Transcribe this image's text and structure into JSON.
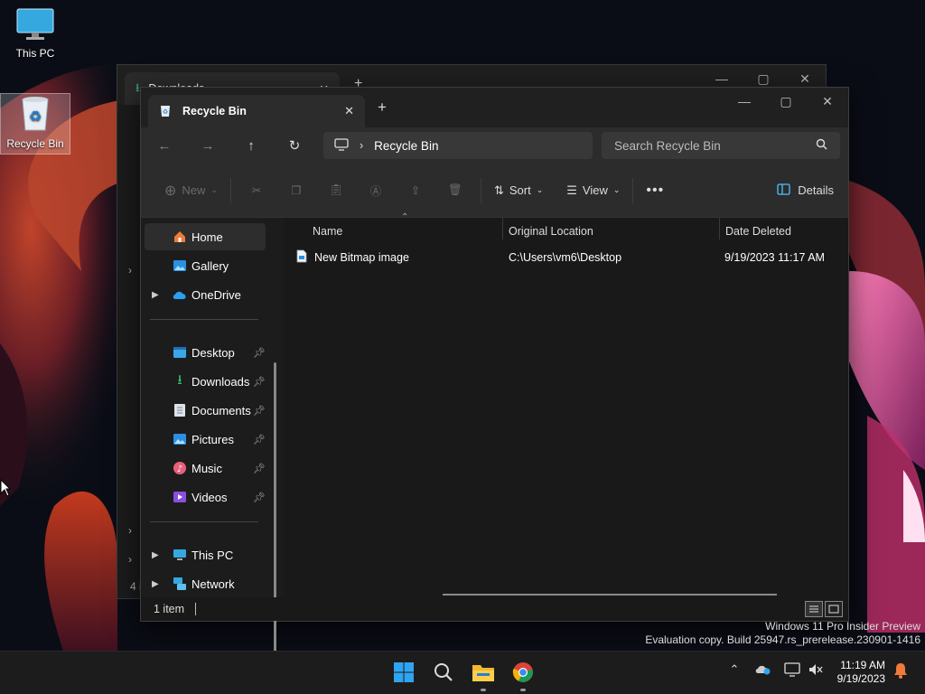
{
  "desktop": {
    "icons": [
      {
        "label": "This PC"
      },
      {
        "label": "Recycle Bin"
      }
    ],
    "watermark": {
      "line1": "Windows 11 Pro Insider Preview",
      "line2": "Evaluation copy. Build 25947.rs_prerelease.230901-1416"
    }
  },
  "background_window": {
    "tab_title": "Downloads",
    "status": "4 i"
  },
  "window": {
    "tab_title": "Recycle Bin",
    "breadcrumb": "Recycle Bin",
    "search_placeholder": "Search Recycle Bin",
    "toolbar": {
      "new_label": "New",
      "sort_label": "Sort",
      "view_label": "View",
      "details_label": "Details"
    },
    "nav": {
      "items": [
        {
          "label": "Home"
        },
        {
          "label": "Gallery"
        },
        {
          "label": "OneDrive"
        },
        {
          "label": "Desktop"
        },
        {
          "label": "Downloads"
        },
        {
          "label": "Documents"
        },
        {
          "label": "Pictures"
        },
        {
          "label": "Music"
        },
        {
          "label": "Videos"
        },
        {
          "label": "This PC"
        },
        {
          "label": "Network"
        }
      ]
    },
    "columns": [
      "Name",
      "Original Location",
      "Date Deleted"
    ],
    "files": [
      {
        "name": "New Bitmap image",
        "location": "C:\\Users\\vm6\\Desktop",
        "date": "9/19/2023 11:17 AM"
      }
    ],
    "status": "1 item"
  },
  "taskbar": {
    "time": "11:19 AM",
    "date": "9/19/2023"
  },
  "colors": {
    "accent": "#4cc2ff",
    "window_bg": "#191919",
    "toolbar_bg": "#2c2c2c"
  }
}
